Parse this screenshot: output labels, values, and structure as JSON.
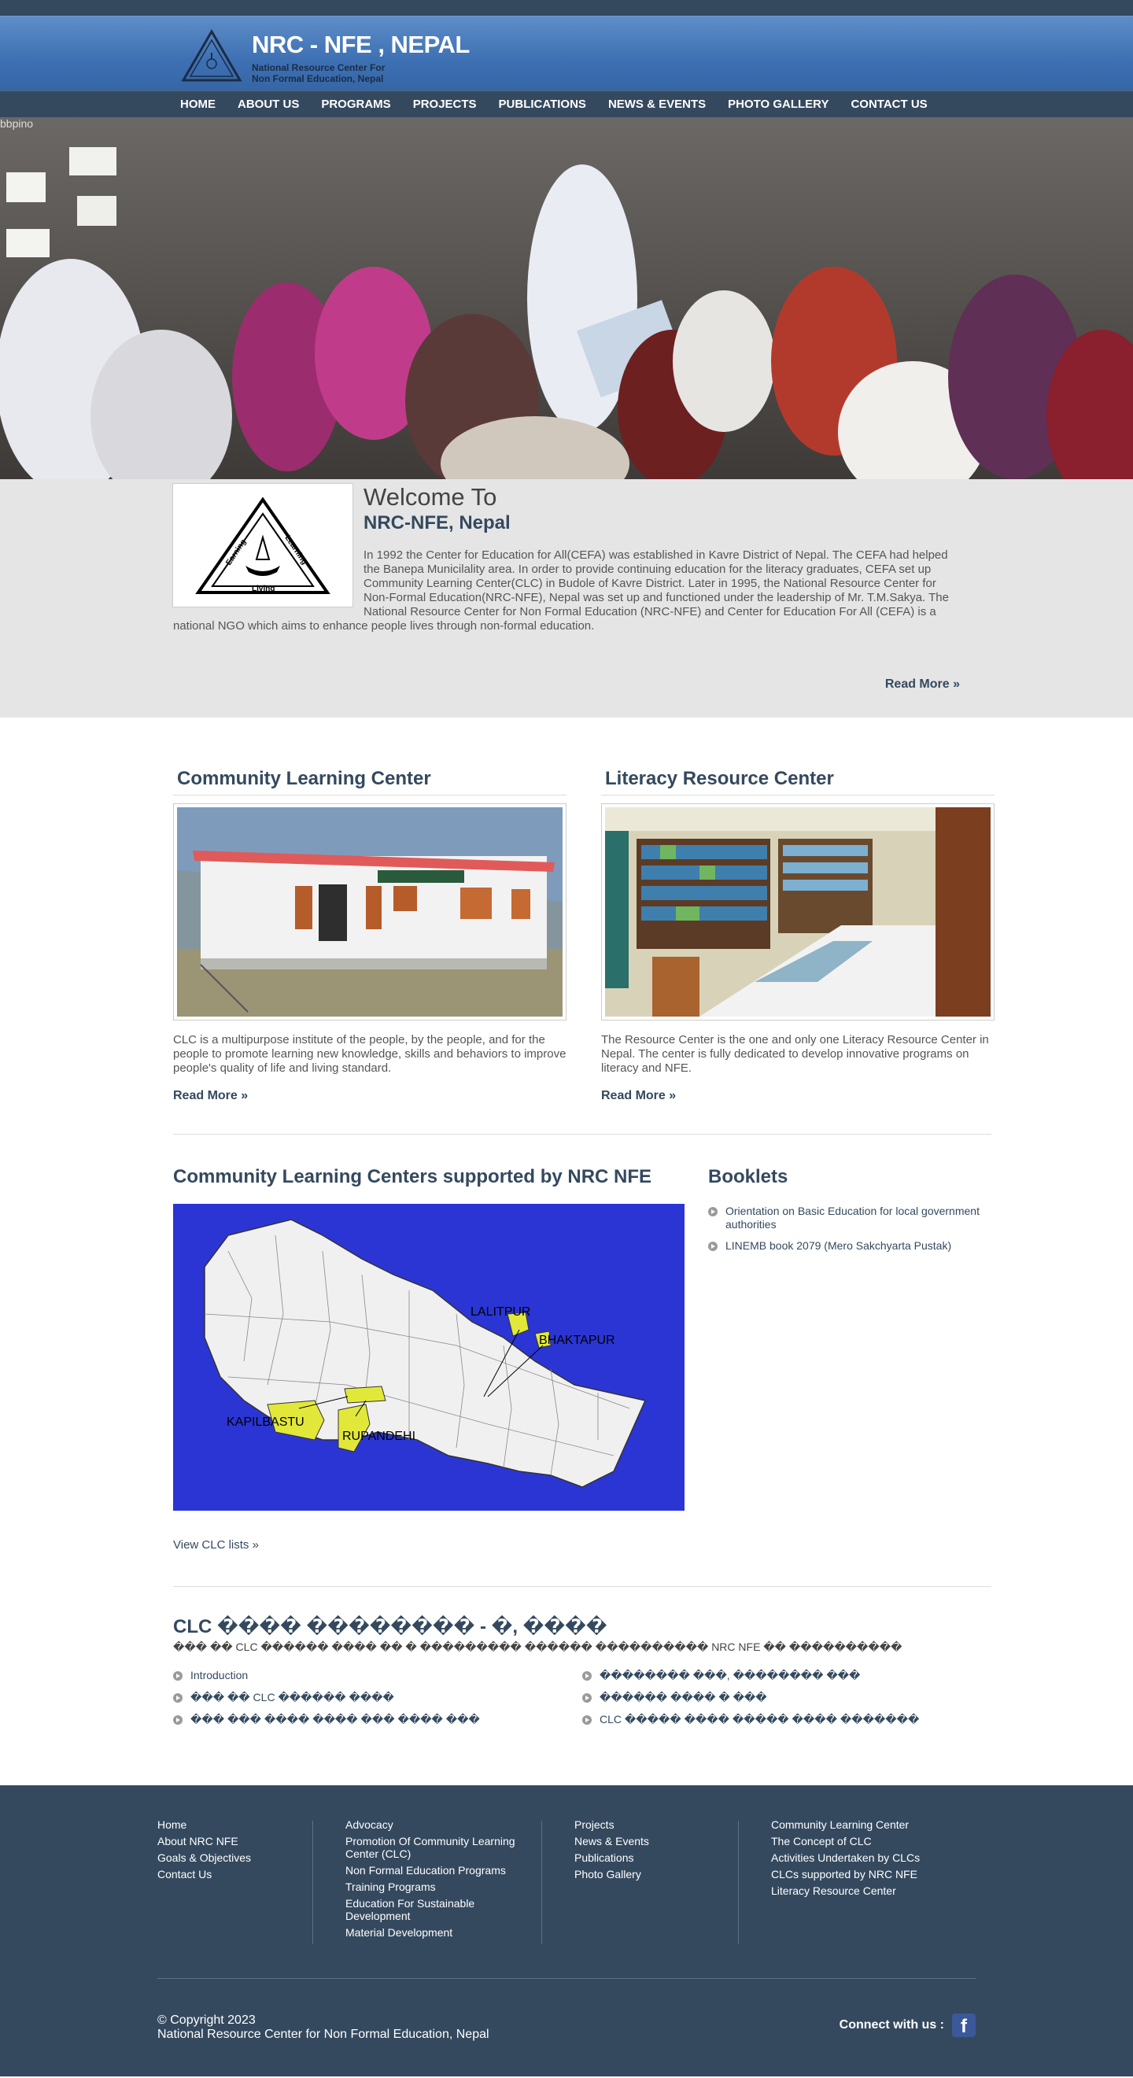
{
  "header": {
    "title": "NRC - NFE , NEPAL",
    "subtitle_line1": "National Resource Center For",
    "subtitle_line2": "Non Formal Education, Nepal"
  },
  "nav": [
    "HOME",
    "ABOUT US",
    "PROGRAMS",
    "PROJECTS",
    "PUBLICATIONS",
    "NEWS & EVENTS",
    "PHOTO GALLERY",
    "CONTACT US"
  ],
  "hero": {
    "broken_alt": "bbpino"
  },
  "welcome": {
    "heading": "Welcome To",
    "subheading": "NRC-NFE, Nepal",
    "body": "In 1992 the Center for Education for All(CEFA) was established in Kavre District of Nepal. The CEFA had helped the Banepa Municilality area. In order to provide continuing education for the literacy graduates, CEFA set up Community Learning Center(CLC) in Budole of Kavre District. Later in 1995, the National Resource Center for Non-Formal Education(NRC-NFE), Nepal was set up and functioned under the leadership of Mr. T.M.Sakya. The National Resource Center for Non Formal Education (NRC-NFE) and Center for Education For All (CEFA) is a national NGO which aims to enhance people lives through non-formal education.",
    "read_more": "Read More »",
    "logo_text_left": "Earning",
    "logo_text_right": "Learning",
    "logo_text_bottom": "Living"
  },
  "centers": [
    {
      "title": "Community Learning Center",
      "text": "CLC is a multipurpose institute of the people, by the people, and for the people to promote learning new knowledge, skills and behaviors to improve people's quality of life and living standard.",
      "read_more": "Read More »"
    },
    {
      "title": "Literacy Resource Center",
      "text": "The Resource Center is the one and only one Literacy Resource Center in Nepal. The center is fully dedicated to develop innovative programs on literacy and NFE.",
      "read_more": "Read More »"
    }
  ],
  "map": {
    "title": "Community Learning Centers supported by NRC NFE",
    "labels": [
      "LALITPUR",
      "BHAKTAPUR",
      "KAPILBASTU",
      "RUPANDEHI"
    ],
    "link": "View CLC lists »"
  },
  "booklets": {
    "title": "Booklets",
    "items": [
      "Orientation on Basic Education for local government authorities",
      "LINEMB book 2079 (Mero Sakchyarta Pustak)"
    ]
  },
  "clc": {
    "title": "CLC ���� �������� - �, ����",
    "subtitle": "��� �� CLC ������ ���� �� � ��������� ������ ���������� NRC NFE �� ����������",
    "col1": [
      "Introduction",
      "��� �� CLC ������ ����",
      "��� ��� ���� ���� ��� ���� ���"
    ],
    "col2": [
      "�������� ���, �������� ���",
      "������ ���� � ���",
      "CLC ����� ���� ����� ���� �������"
    ]
  },
  "footer": {
    "col1": [
      "Home",
      "About NRC NFE",
      "Goals & Objectives",
      "Contact Us"
    ],
    "col2": [
      "Advocacy",
      "Promotion Of Community Learning Center (CLC)",
      "Non Formal Education Programs",
      "Training Programs",
      "Education For Sustainable Development",
      "Material Development"
    ],
    "col3": [
      "Projects",
      "News & Events",
      "Publications",
      "Photo Gallery"
    ],
    "col4": [
      "Community Learning Center",
      "The Concept of CLC",
      "Activities Undertaken by CLCs",
      "CLCs supported by NRC NFE",
      "Literacy Resource Center"
    ],
    "copyright": "© Copyright 2023",
    "org": "National Resource Center for Non Formal Education, Nepal",
    "connect": "Connect with us :",
    "facebook_icon": "f"
  }
}
